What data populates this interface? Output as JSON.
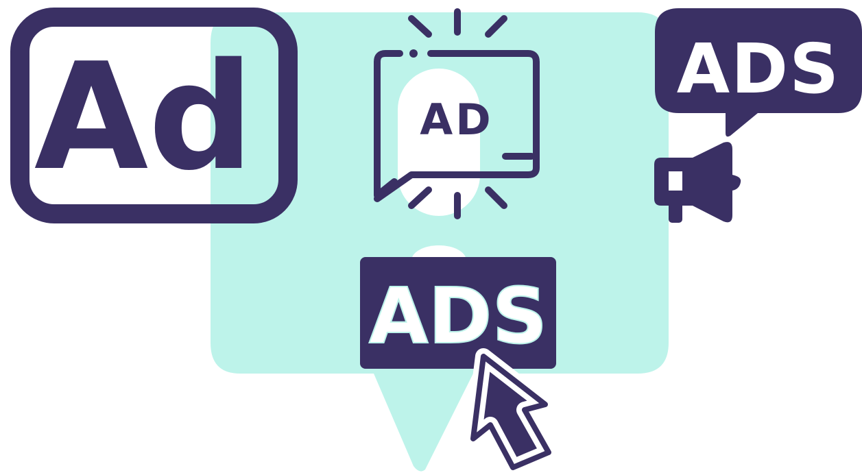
{
  "colors": {
    "ink": "#3a3064",
    "mint": "#bdf3ea",
    "background": "#ffffff"
  },
  "icons": {
    "ad_box": {
      "name": "ad-box-icon",
      "label": "Ad"
    },
    "ad_monitor": {
      "name": "ad-monitor-spotlight-icon",
      "label": "AD"
    },
    "ads_speech_megaphone": {
      "name": "ads-speech-bubble-megaphone-icon",
      "label": "ADS"
    },
    "ads_click": {
      "name": "ads-click-cursor-icon",
      "label": "ADS"
    }
  }
}
